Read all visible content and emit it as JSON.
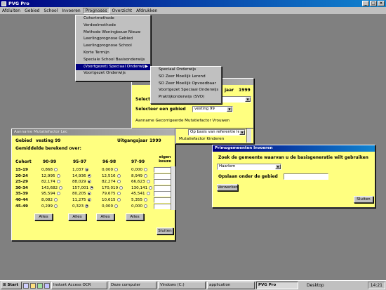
{
  "app": {
    "title": "PVG Pro"
  },
  "menubar": [
    "Afsluiten",
    "Gebied",
    "School",
    "Invoeren",
    "Prognoses",
    "Overzicht",
    "Afdrukken"
  ],
  "prognoses_menu": [
    "Cohortmethode",
    "Verdeelmethode",
    "Methode Woningbouw Nieuw",
    "Leerlingprognose Gebied",
    "Leerlingprognose School",
    "Korte Termijn",
    "Speciale School Basisonderwijs",
    "(Voortgezet) Speciaal Onderwijs",
    "Voortgezet Onderwijs"
  ],
  "submenu": [
    "Speciaal Onderwijs",
    "SO Zeer Moeilijk Lerend",
    "SO Zeer Moeilijk Opvoedbaar",
    "Voortgezet Speciaal Onderwijs",
    "Praktijkonderwijs (SVO)"
  ],
  "bg_window": {
    "uitgangsjaar_label": "jaar",
    "uitgangsjaar": "1999",
    "select_label": "Selecter",
    "select_gebied_label": "Selecteer een gebied",
    "gebied_value": "vesting 99",
    "aanname_text": "Aanname Gecorrigeerde Mutatiefactor Vrouwen",
    "aanname_select": "Op basis van referentie leç",
    "kinderen_text": "Mutatiefactor Kinderen"
  },
  "mutatie_window": {
    "title": "Aanname Mutatiefactor Lec",
    "gebied_label": "Gebied",
    "gebied_value": "vesting 99",
    "uitgangsjaar_label": "Uitgangsjaar",
    "uitgangsjaar": "1999",
    "gemiddelde_label": "Gemiddelde berekend over:",
    "headers": [
      "Cohort",
      "90-99",
      "95-97",
      "96-98",
      "97-99",
      "eigen keuze"
    ],
    "rows": [
      {
        "cohort": "15-19",
        "v": [
          "0,868",
          "1,037",
          "0,000",
          "0,000"
        ],
        "sel": 1
      },
      {
        "cohort": "20-24",
        "v": [
          "12,995",
          "14,936",
          "12,516",
          "8,949"
        ],
        "sel": 1
      },
      {
        "cohort": "25-29",
        "v": [
          "82,174",
          "88,029",
          "82,274",
          "66,623"
        ],
        "sel": 1
      },
      {
        "cohort": "30-34",
        "v": [
          "143,682",
          "157,001",
          "170,019",
          "130,141"
        ],
        "sel": 1
      },
      {
        "cohort": "35-39",
        "v": [
          "95,594",
          "80,205",
          "79,675",
          "45,541"
        ],
        "sel": 1
      },
      {
        "cohort": "40-44",
        "v": [
          "8,082",
          "11,275",
          "10,615",
          "5,355"
        ],
        "sel": 1
      },
      {
        "cohort": "45-49",
        "v": [
          "0,299",
          "0,323",
          "0,000",
          "0,000"
        ],
        "sel": 1
      }
    ],
    "alles": "Alles",
    "sluiten": "Sluiten"
  },
  "prim_window": {
    "title": "Primogemeenten Invoeren",
    "question": "Zoek de gemeente waarvan u de basisgeneratie wilt gebruiken",
    "gemeente_value": "Haarlem",
    "opslaan_label": "Opslaan onder de gebied",
    "verwerken": "Verwerken",
    "sluiten": "Sluiten"
  },
  "taskbar": {
    "start": "Start",
    "items": [
      "Instant Access OCR",
      "Deze computer",
      "Vindows (C:)",
      "application",
      "PVG Pro"
    ],
    "active_index": 4,
    "desktop_label": "Desktop",
    "clock": "14:21"
  }
}
